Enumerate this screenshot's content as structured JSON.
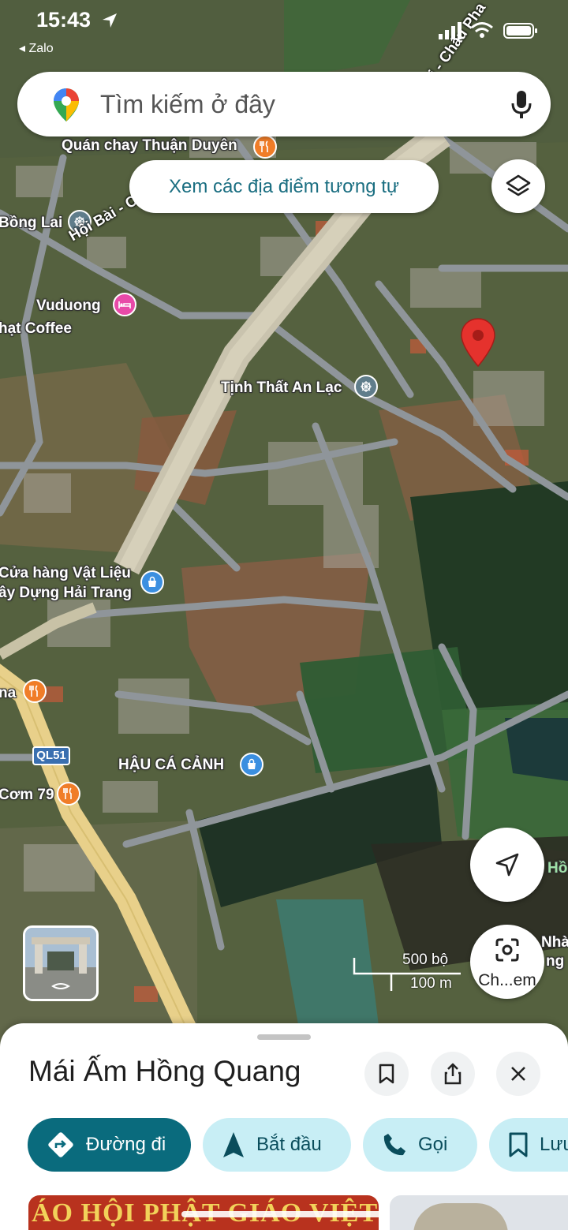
{
  "status_bar": {
    "time": "15:43",
    "back_app": "◂ Zalo"
  },
  "search": {
    "placeholder": "Tìm kiếm ở đây"
  },
  "chips": {
    "similar_places": "Xem các địa điểm tương tự"
  },
  "map_labels": {
    "poi_thuan_duyen": "Quán chay Thuận Duyên",
    "poi_bong_lai": "Bồng Lai",
    "road_hoi_bai": "Hội Bài - Châu P",
    "road_chau_pha_top": "i - Châu Pha",
    "poi_vuduong": "Vuduong",
    "poi_hat_coffee": "hạt Coffee",
    "poi_tinh_that": "Tịnh Thất An Lạc",
    "poi_vat_lieu_1": "Cửa hàng Vật Liệu",
    "poi_vat_lieu_2": "ây Dựng Hải Trang",
    "poi_na": "na",
    "route_badge": "QL51",
    "poi_hau_ca_canh": "HẬU CÁ CẢNH",
    "poi_com79": "Cơm 79",
    "edge_ho": "Hồ",
    "edge_nha": "Nhà",
    "edge_ng": "ng"
  },
  "controls": {
    "lens_label": "Ch...em"
  },
  "scale": {
    "imperial": "500 bộ",
    "metric": "100 m"
  },
  "place": {
    "name": "Mái Ấm Hồng Quang"
  },
  "actions": {
    "directions": "Đường đi",
    "start": "Bắt đầu",
    "call": "Gọi",
    "save": "Lưu"
  },
  "photos": {
    "banner_text": "ÁO HỘI PHẬT GIÁO VIỆT"
  },
  "colors": {
    "accent_teal": "#0a6b7d",
    "chip_light": "#c8eef5",
    "pin_red": "#e5322d",
    "poi_orange": "#f07d28",
    "poi_blue": "#3b8fe0",
    "poi_pink": "#e84aa8",
    "poi_slate": "#607d8b",
    "highway": "#e8d08a"
  },
  "icons": {
    "search_logo": "google-maps-pin-icon",
    "mic": "microphone-icon",
    "layers": "layers-icon",
    "locate": "navigation-arrow-icon",
    "lens": "camera-lens-icon",
    "save": "bookmark-icon",
    "share": "share-icon",
    "close": "close-icon",
    "directions": "directions-diamond-icon",
    "start": "navigation-triangle-icon",
    "call": "phone-icon"
  }
}
